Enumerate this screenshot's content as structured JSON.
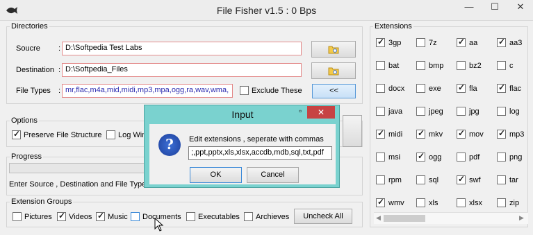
{
  "window": {
    "title": "File Fisher v1.5 : 0 Bps",
    "min": "—",
    "max": "☐",
    "close": "✕"
  },
  "directories": {
    "label": "Directories",
    "source_label": "Soucre",
    "source_colon": ":",
    "source_value": "D:\\Softpedia Test Labs",
    "dest_label": "Destination",
    "dest_colon": ":",
    "dest_value": "D:\\Softpedia_Files",
    "types_label": "File Types",
    "types_colon": ":",
    "types_value": "mr,flac,m4a,mid,midi,mp3,mpa,ogg,ra,wav,wma,",
    "exclude_label": "Exclude These",
    "exclude_checked": false,
    "toggle_button": "<<"
  },
  "options": {
    "label": "Options",
    "preserve_label": "Preserve File Structure",
    "preserve_checked": true,
    "log_label": "Log Win",
    "log_checked": false
  },
  "progress": {
    "label": "Progress",
    "status": "Enter Source , Destination and File Type",
    "value": 0
  },
  "groups": {
    "label": "Extension Groups",
    "items": [
      {
        "label": "Pictures",
        "checked": false
      },
      {
        "label": "Videos",
        "checked": true
      },
      {
        "label": "Music",
        "checked": true
      },
      {
        "label": "Documents",
        "checked": false
      },
      {
        "label": "Executables",
        "checked": false
      },
      {
        "label": "Archieves",
        "checked": false
      }
    ],
    "uncheck_all": "Uncheck All"
  },
  "extensions": {
    "label": "Extensions",
    "items": [
      {
        "label": "3gp",
        "checked": true
      },
      {
        "label": "7z",
        "checked": false
      },
      {
        "label": "aa",
        "checked": true
      },
      {
        "label": "aa3",
        "checked": true
      },
      {
        "label": "bat",
        "checked": false
      },
      {
        "label": "bmp",
        "checked": false
      },
      {
        "label": "bz2",
        "checked": false
      },
      {
        "label": "c",
        "checked": false
      },
      {
        "label": "docx",
        "checked": false
      },
      {
        "label": "exe",
        "checked": false
      },
      {
        "label": "fla",
        "checked": true
      },
      {
        "label": "flac",
        "checked": true
      },
      {
        "label": "java",
        "checked": false
      },
      {
        "label": "jpeg",
        "checked": false
      },
      {
        "label": "jpg",
        "checked": false
      },
      {
        "label": "log",
        "checked": false
      },
      {
        "label": "midi",
        "checked": true
      },
      {
        "label": "mkv",
        "checked": true
      },
      {
        "label": "mov",
        "checked": true
      },
      {
        "label": "mp3",
        "checked": true
      },
      {
        "label": "msi",
        "checked": false
      },
      {
        "label": "ogg",
        "checked": true
      },
      {
        "label": "pdf",
        "checked": false
      },
      {
        "label": "png",
        "checked": false
      },
      {
        "label": "rpm",
        "checked": false
      },
      {
        "label": "sql",
        "checked": false
      },
      {
        "label": "swf",
        "checked": true
      },
      {
        "label": "tar",
        "checked": false
      },
      {
        "label": "wmv",
        "checked": true
      },
      {
        "label": "xls",
        "checked": false
      },
      {
        "label": "xlsx",
        "checked": false
      },
      {
        "label": "zip",
        "checked": false
      }
    ]
  },
  "dialog": {
    "title": "Input",
    "close": "✕",
    "min": "▫",
    "message": "Edit extensions , seperate with commas",
    "input_value": ";,ppt,pptx,xls,xlsx,accdb,mdb,sql,txt,pdf",
    "ok": "OK",
    "cancel": "Cancel",
    "icon_glyph": "?"
  }
}
